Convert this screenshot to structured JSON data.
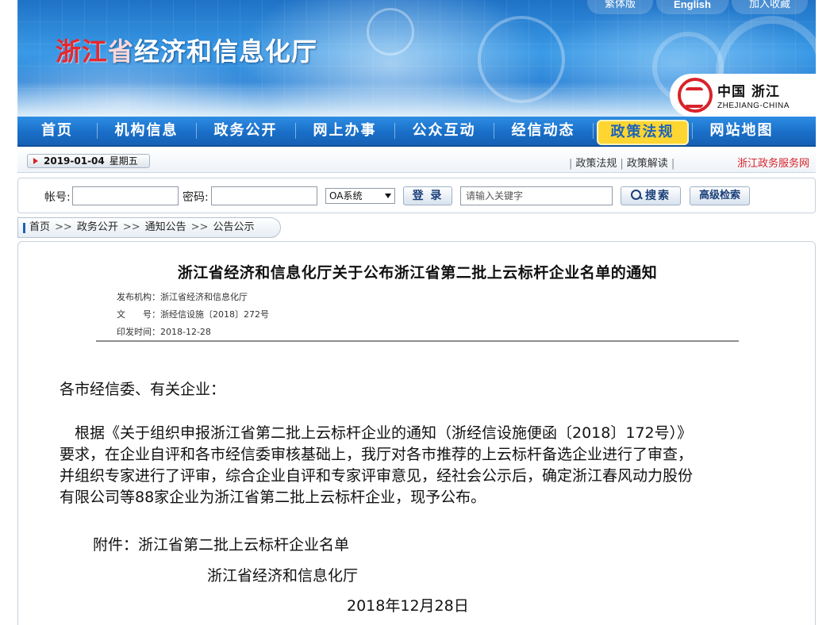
{
  "header": {
    "title_part1": "浙江",
    "title_part2": "省",
    "title_part3": "经济和信息化厅",
    "top_links": [
      "繁体版",
      "English",
      "加入收藏"
    ],
    "logo_zh": "中国 浙江",
    "logo_en": "ZHEJIANG-CHINA"
  },
  "nav": {
    "items": [
      "首页",
      "机构信息",
      "政务公开",
      "网上办事",
      "公众互动",
      "经信动态",
      "政策法规",
      "网站地图"
    ],
    "active": "政策法规"
  },
  "datebar": {
    "date": "2019-01-04",
    "weekday": "星期五",
    "links": [
      "政策法规",
      "政策解读"
    ],
    "gov_service": "浙江政务服务网"
  },
  "login": {
    "account_label": "帐号:",
    "password_label": "密码:",
    "system_select": "OA系统",
    "login_button": "登 录",
    "search_placeholder": "请输入关键字",
    "search_button": "搜索",
    "advanced_search": "高级检索"
  },
  "breadcrumb": [
    "首页",
    "政务公开",
    "通知公告",
    "公告公示"
  ],
  "breadcrumb_sep": ">>",
  "article": {
    "title": "浙江省经济和信息化厅关于公布浙江省第二批上云标杆企业名单的通知",
    "meta": {
      "issuer_label": "发布机构：",
      "issuer": "浙江省经济和信息化厅",
      "doc_no_label": "文　　号：",
      "doc_no": "浙经信设施〔2018〕272号",
      "date_label": "印发时间：",
      "date": "2018-12-28"
    },
    "salutation": "各市经信委、有关企业：",
    "paragraph_lines": [
      "　根据《关于组织申报浙江省第二批上云标杆企业的通知（浙经信设施便函〔2018〕172号）》",
      "要求，在企业自评和各市经信委审核基础上，我厅对各市推荐的上云标杆备选企业进行了审查，",
      "并组织专家进行了评审，综合企业自评和专家评审意见，经社会公示后，确定浙江春风动力股份",
      "有限公司等88家企业为浙江省第二批上云标杆企业，现予公布。"
    ],
    "attachment": "附件：浙江省第二批上云标杆企业名单",
    "signature": "浙江省经济和信息化厅",
    "sign_date": "2018年12月28日"
  }
}
